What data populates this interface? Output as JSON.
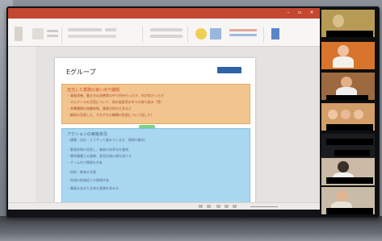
{
  "presentation": {
    "slide_title": "Eグループ",
    "orange_box": {
      "heading": "担当した業務の良い点や課題",
      "lines": [
        "・業務改善、働き方の改善等の中で何を行ったか、何が良かったか",
        "・エビデンスの活用について、他の施設等の中での取り組み（等）",
        "・多職種間の協働体制、業務分担の工夫など",
        "（業務の見直しと、それぞれの職種の役割について話した）"
      ]
    },
    "blue_box": {
      "heading": "アクションの実施状況",
      "lines": [
        "（課題・対応・どうやって進めているか、理想の観点）",
        "・勤務体制の見直し、業務の効率化を重視",
        "・関係職種との連携、意見交換の場を設ける",
        "・チーム内で情報を共有",
        "・研修・教育の充実",
        "・地域の他施設との情報共有",
        "・職員を含めた全体の意識を高める"
      ]
    }
  },
  "participants": [
    {
      "id": "p1"
    },
    {
      "id": "p2"
    },
    {
      "id": "p3"
    },
    {
      "id": "p4"
    },
    {
      "id": "p5"
    },
    {
      "id": "p6"
    },
    {
      "id": "p7"
    }
  ],
  "colors": {
    "ppt_titlebar": "#c4482f",
    "orange_box": "#f2c58e",
    "blue_box": "#a9d7f0",
    "connector": "#7dcf8a"
  },
  "icons": {
    "window_controls": [
      "minimize-icon",
      "maximize-icon",
      "close-icon"
    ]
  }
}
